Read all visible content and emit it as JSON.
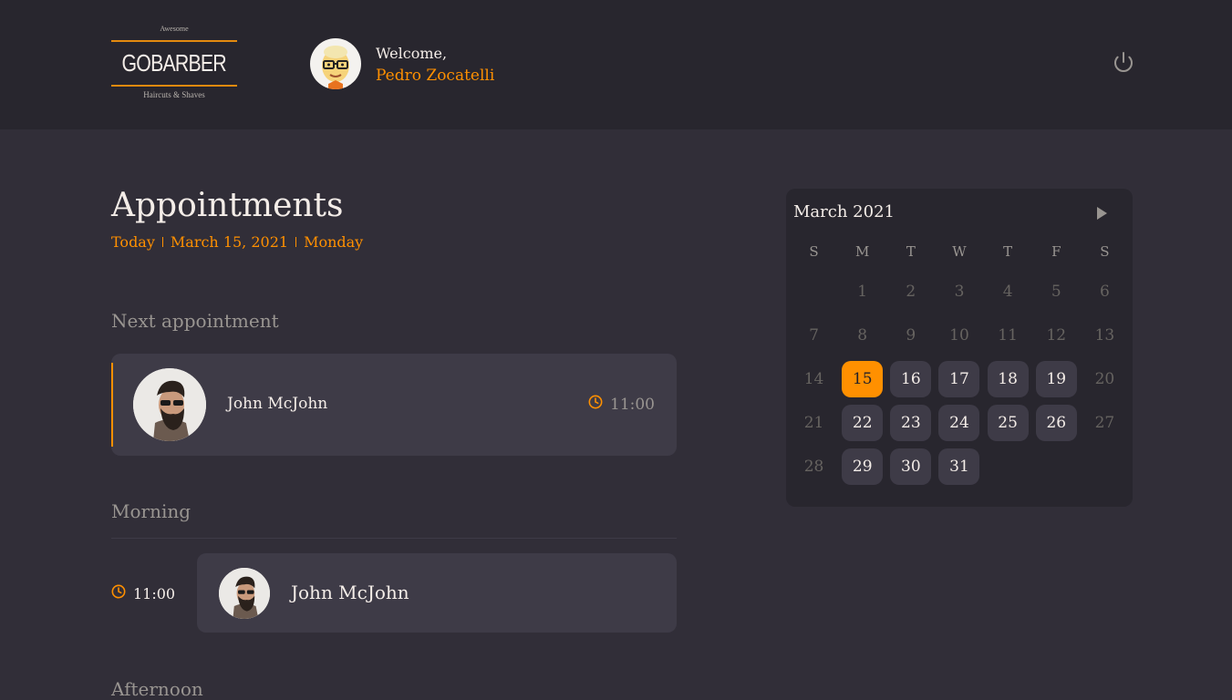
{
  "colors": {
    "accent": "#ff9000",
    "background": "#312e38",
    "header": "#28262e",
    "card": "#3e3b47",
    "muted": "#999591",
    "text": "#f4ede8"
  },
  "header": {
    "logo": {
      "top": "Awesome",
      "title": "GOBARBER",
      "bottom": "Haircuts & Shaves"
    },
    "welcome_label": "Welcome,",
    "user_name": "Pedro Zocatelli",
    "power_icon": "power-icon"
  },
  "main": {
    "title": "Appointments",
    "date": {
      "today": "Today",
      "date": "March 15, 2021",
      "weekday": "Monday"
    },
    "next_label": "Next appointment",
    "next": {
      "name": "John McJohn",
      "time": "11:00",
      "icon": "clock-icon"
    },
    "morning_label": "Morning",
    "morning": [
      {
        "time": "11:00",
        "name": "John McJohn",
        "icon": "clock-icon"
      }
    ],
    "afternoon_label": "Afternoon"
  },
  "calendar": {
    "month": "March 2021",
    "next_icon": "triangle-right-icon",
    "weekdays": [
      "S",
      "M",
      "T",
      "W",
      "T",
      "F",
      "S"
    ],
    "leading_blanks": 1,
    "days": 31,
    "selected_day": 15,
    "available_days": [
      15,
      16,
      17,
      18,
      19,
      22,
      23,
      24,
      25,
      26,
      29,
      30,
      31
    ]
  }
}
